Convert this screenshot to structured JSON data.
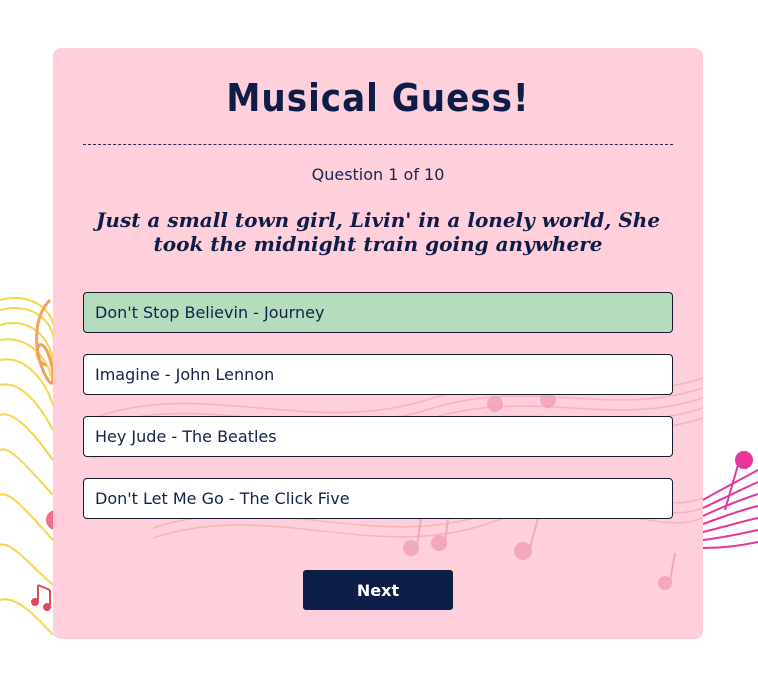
{
  "quiz": {
    "title": "Musical Guess!",
    "progress": {
      "text": "Question 1 of 10",
      "current": 1,
      "total": 10
    },
    "lyrics": "Just a small town girl, Livin' in a lonely world, She took the midnight train going anywhere",
    "options": [
      {
        "label": "Don't Stop Believin - Journey",
        "selected": true
      },
      {
        "label": "Imagine - John Lennon",
        "selected": false
      },
      {
        "label": "Hey Jude - The Beatles",
        "selected": false
      },
      {
        "label": "Don't Let Me Go - The Click Five",
        "selected": false
      }
    ],
    "next_label": "Next"
  },
  "colors": {
    "card_background": "#ffcdda",
    "title_text": "#0e1d47",
    "selected_option": "#b5dcbc",
    "button": "#0e1d47",
    "button_text": "#ffffff",
    "staff_yellow": "#f5d64a",
    "staff_magenta": "#e8359a"
  }
}
